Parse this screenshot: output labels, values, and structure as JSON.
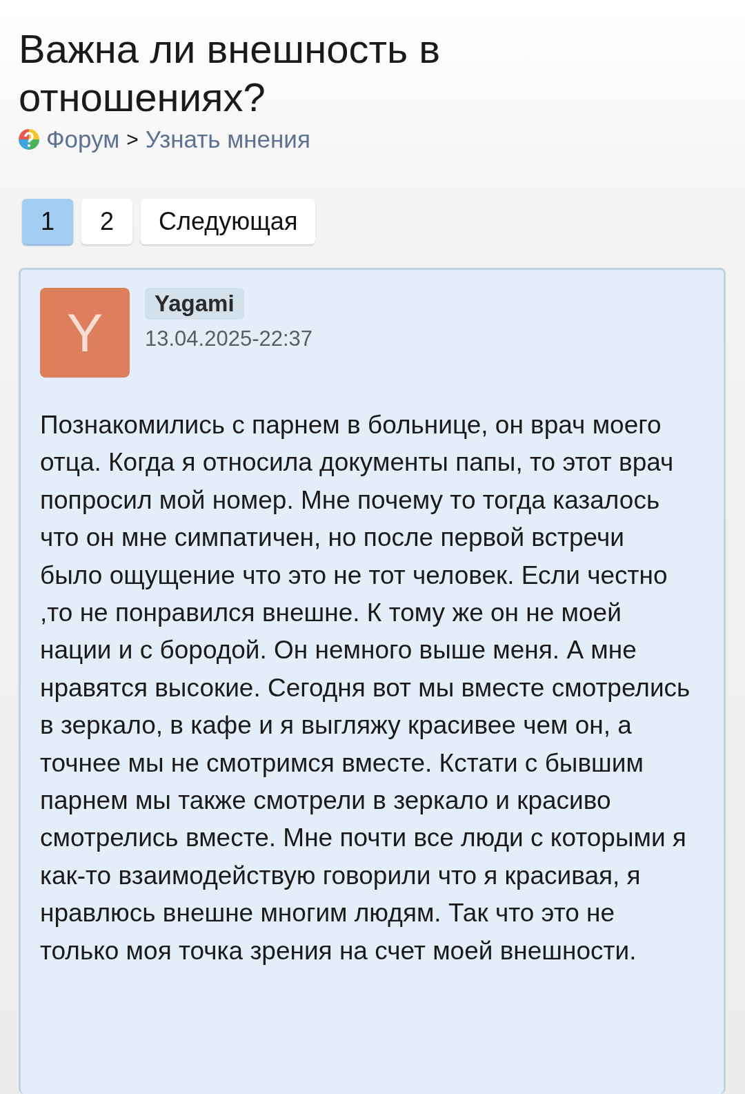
{
  "title": "Важна ли внешность в отношениях?",
  "breadcrumb": [
    {
      "label": "Форум"
    },
    {
      "label": "Узнать мнения"
    }
  ],
  "breadcrumb_separator": ">",
  "pagination": [
    {
      "label": "1",
      "selected": true
    },
    {
      "label": "2",
      "selected": false
    },
    {
      "label": "Следующая",
      "selected": false
    }
  ],
  "post": {
    "avatar_letter": "Y",
    "author": "Yagami",
    "date": "13.04.2025-22:37",
    "text": "Познакомились с парнем в больнице, он врач моего отца. Когда я относила документы папы, то этот врач попросил мой номер. Мне почему то тогда казалось что он мне симпатичен, но после первой встречи было ощущение что это не тот человек. Если честно ,то не понравился внешне. К тому же он не моей нации и с бородой. Он немного выше меня. А мне нравятся высокие. Сегодня вот мы вместе смотрелись в зеркало, в кафе и я выгляжу красивее чем он, а точнее мы не смотримся вместе. Кстати с бывшим парнем мы также смотрели в зеркало и красиво смотрелись вместе. Мне почти все люди с которыми я как-то взаимодействую говорили что я красивая, я нравлюсь внешне многим людям. Так что это не только моя точка зрения на счет моей внешности."
  }
}
